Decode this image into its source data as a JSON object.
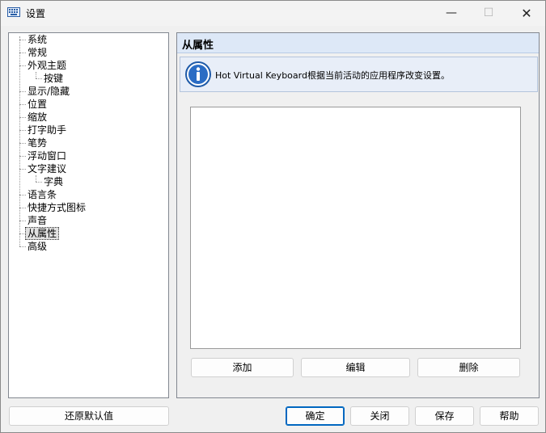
{
  "window": {
    "title": "设置",
    "minimize_glyph": "—",
    "maximize_glyph": "☐",
    "close_glyph": "✕"
  },
  "tree": {
    "items": [
      {
        "label": "系统"
      },
      {
        "label": "常规"
      },
      {
        "label": "外观主题"
      },
      {
        "label": "按键"
      },
      {
        "label": "显示/隐藏"
      },
      {
        "label": "位置"
      },
      {
        "label": "缩放"
      },
      {
        "label": "打字助手"
      },
      {
        "label": "笔势"
      },
      {
        "label": "浮动窗口"
      },
      {
        "label": "文字建议"
      },
      {
        "label": "字典"
      },
      {
        "label": "语言条"
      },
      {
        "label": "快捷方式图标"
      },
      {
        "label": "声音"
      },
      {
        "label": "从属性"
      },
      {
        "label": "高级"
      }
    ],
    "selected": "从属性"
  },
  "panel": {
    "title": "从属性",
    "info": "Hot Virtual Keyboard根据当前活动的应用程序改变设置。",
    "buttons": {
      "add": "添加",
      "edit": "编辑",
      "delete": "删除"
    }
  },
  "footer": {
    "restore_defaults": "还原默认值",
    "ok": "确定",
    "close": "关闭",
    "save": "保存",
    "help": "帮助"
  },
  "colors": {
    "accent": "#0067c0",
    "panel_header": "#dde8f7",
    "info_icon": "#1e5aa8"
  }
}
